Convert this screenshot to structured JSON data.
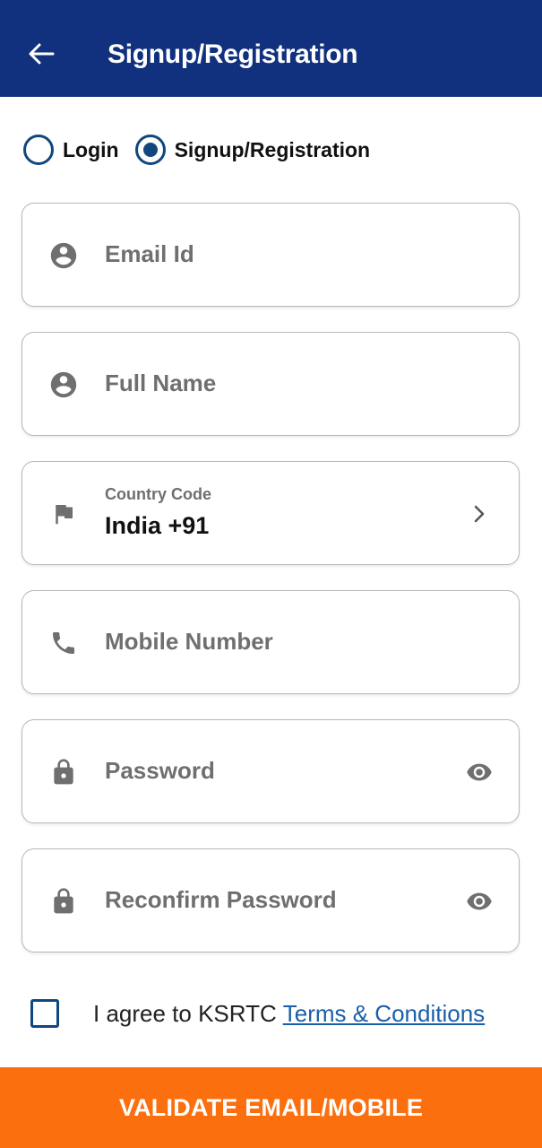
{
  "header": {
    "title": "Signup/Registration",
    "back_icon": "arrow-left-icon",
    "background": "#11317f"
  },
  "mode": {
    "options": [
      {
        "label": "Login",
        "selected": false
      },
      {
        "label": "Signup/Registration",
        "selected": true
      }
    ],
    "accent": "#11477f"
  },
  "fields": {
    "email": {
      "placeholder": "Email Id",
      "icon": "account-circle-icon"
    },
    "full_name": {
      "placeholder": "Full Name",
      "icon": "account-circle-icon"
    },
    "country_code": {
      "label": "Country Code",
      "value": "India +91",
      "icon": "flag-icon",
      "trailing_icon": "chevron-right-icon"
    },
    "mobile": {
      "placeholder": "Mobile Number",
      "icon": "phone-icon"
    },
    "password": {
      "placeholder": "Password",
      "icon": "lock-icon",
      "trailing_icon": "eye-icon"
    },
    "reconfirm_password": {
      "placeholder": "Reconfirm Password",
      "icon": "lock-icon",
      "trailing_icon": "eye-icon"
    }
  },
  "agreement": {
    "checked": false,
    "text": "I agree to KSRTC",
    "link_text": "Terms & Conditions",
    "link_color": "#1a5fa8"
  },
  "cta": {
    "label": "VALIDATE EMAIL/MOBILE",
    "color": "#fb6f0f"
  }
}
